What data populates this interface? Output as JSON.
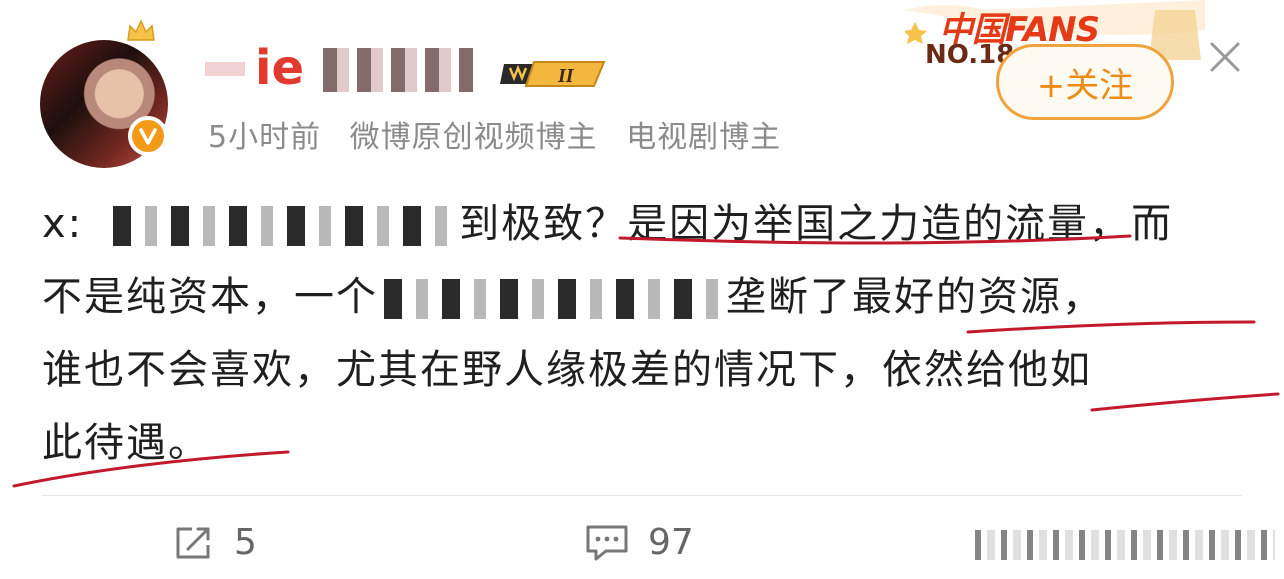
{
  "post": {
    "username": "ie",
    "timestamp": "5小时前",
    "tags": [
      "微博原创视频博主",
      "电视剧博主"
    ],
    "level_badge": "II",
    "fans_banner": {
      "title": "中国FANS",
      "number": "NO.18"
    },
    "follow_label": "+关注",
    "content_lines": [
      {
        "prefix": "x:",
        "suffix": "到极致？是因为举国之力造的流量，而"
      },
      {
        "prefix": "不是纯资本，一个",
        "suffix": "垄断了最好的资源，"
      },
      {
        "text": "谁也不会喜欢，尤其在野人缘极差的情况下，依然给他如"
      },
      {
        "text": "此待遇。"
      }
    ]
  },
  "actions": {
    "share_count": "5",
    "comment_count": "97"
  },
  "colors": {
    "accent": "#f0a23c",
    "username": "#e23a2e",
    "verified": "#f39b19",
    "annotation": "#c21a2c"
  },
  "icons": [
    "crown-icon",
    "verified-icon",
    "close-icon",
    "share-icon",
    "comment-icon",
    "like-icon"
  ]
}
